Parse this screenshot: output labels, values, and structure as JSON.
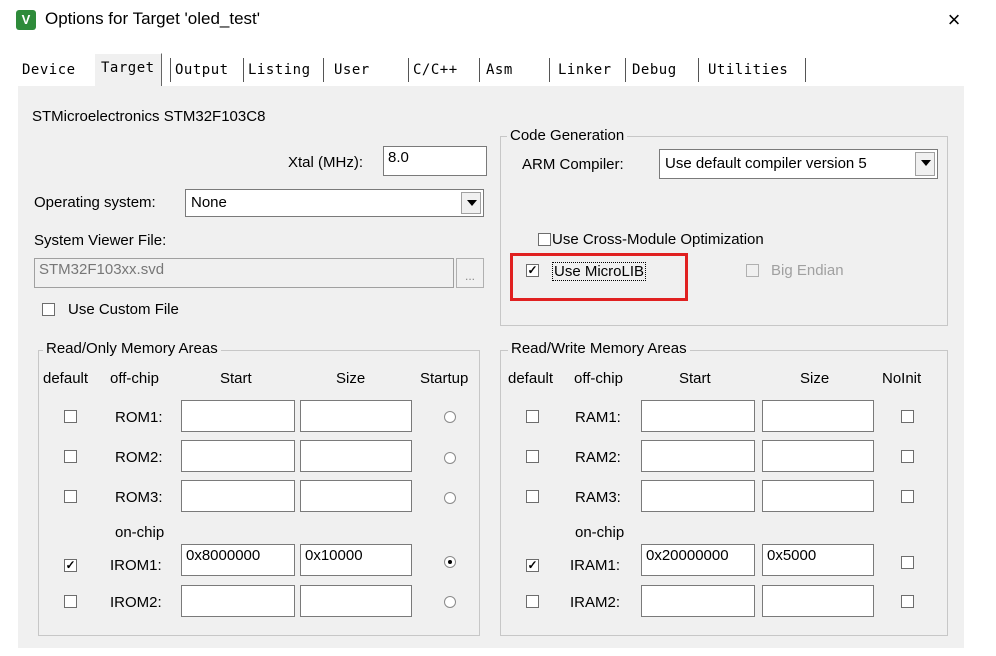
{
  "window": {
    "title": "Options for Target 'oled_test'",
    "close_glyph": "×",
    "app_icon_glyph": "V"
  },
  "tabs": [
    {
      "label": "Device"
    },
    {
      "label": "Target"
    },
    {
      "label": "Output"
    },
    {
      "label": "Listing"
    },
    {
      "label": "User"
    },
    {
      "label": "C/C++"
    },
    {
      "label": "Asm"
    },
    {
      "label": "Linker"
    },
    {
      "label": "Debug"
    },
    {
      "label": "Utilities"
    }
  ],
  "active_tab": "Target",
  "device_name": "STMicroelectronics STM32F103C8",
  "xtal": {
    "label": "Xtal (MHz):",
    "value": "8.0"
  },
  "os": {
    "label": "Operating system:",
    "value": "None"
  },
  "svd": {
    "label": "System Viewer File:",
    "value": "STM32F103xx.svd",
    "browse": "...",
    "custom_label": "Use Custom File",
    "custom_checked": false
  },
  "code_gen": {
    "title": "Code Generation",
    "compiler_label": "ARM Compiler:",
    "compiler_value": "Use default compiler version 5",
    "cross_module_label": "Use Cross-Module Optimization",
    "cross_module_checked": false,
    "microlib_label": "Use MicroLIB",
    "microlib_checked": true,
    "big_endian_label": "Big Endian",
    "big_endian_checked": false
  },
  "ro_memory": {
    "title": "Read/Only Memory Areas",
    "headers": {
      "default": "default",
      "offchip": "off-chip",
      "start": "Start",
      "size": "Size",
      "startup": "Startup"
    },
    "onchip_label": "on-chip",
    "rows": [
      {
        "name": "ROM1:",
        "default": false,
        "start": "",
        "size": "",
        "startup": false
      },
      {
        "name": "ROM2:",
        "default": false,
        "start": "",
        "size": "",
        "startup": false
      },
      {
        "name": "ROM3:",
        "default": false,
        "start": "",
        "size": "",
        "startup": false
      },
      {
        "name": "IROM1:",
        "default": true,
        "start": "0x8000000",
        "size": "0x10000",
        "startup": true
      },
      {
        "name": "IROM2:",
        "default": false,
        "start": "",
        "size": "",
        "startup": false
      }
    ]
  },
  "rw_memory": {
    "title": "Read/Write Memory Areas",
    "headers": {
      "default": "default",
      "offchip": "off-chip",
      "start": "Start",
      "size": "Size",
      "noinit": "NoInit"
    },
    "onchip_label": "on-chip",
    "rows": [
      {
        "name": "RAM1:",
        "default": false,
        "start": "",
        "size": "",
        "noinit": false
      },
      {
        "name": "RAM2:",
        "default": false,
        "start": "",
        "size": "",
        "noinit": false
      },
      {
        "name": "RAM3:",
        "default": false,
        "start": "",
        "size": "",
        "noinit": false
      },
      {
        "name": "IRAM1:",
        "default": true,
        "start": "0x20000000",
        "size": "0x5000",
        "noinit": false
      },
      {
        "name": "IRAM2:",
        "default": false,
        "start": "",
        "size": "",
        "noinit": false
      }
    ]
  },
  "colors": {
    "highlight": "#e02020",
    "panel": "#f0f0f0"
  }
}
